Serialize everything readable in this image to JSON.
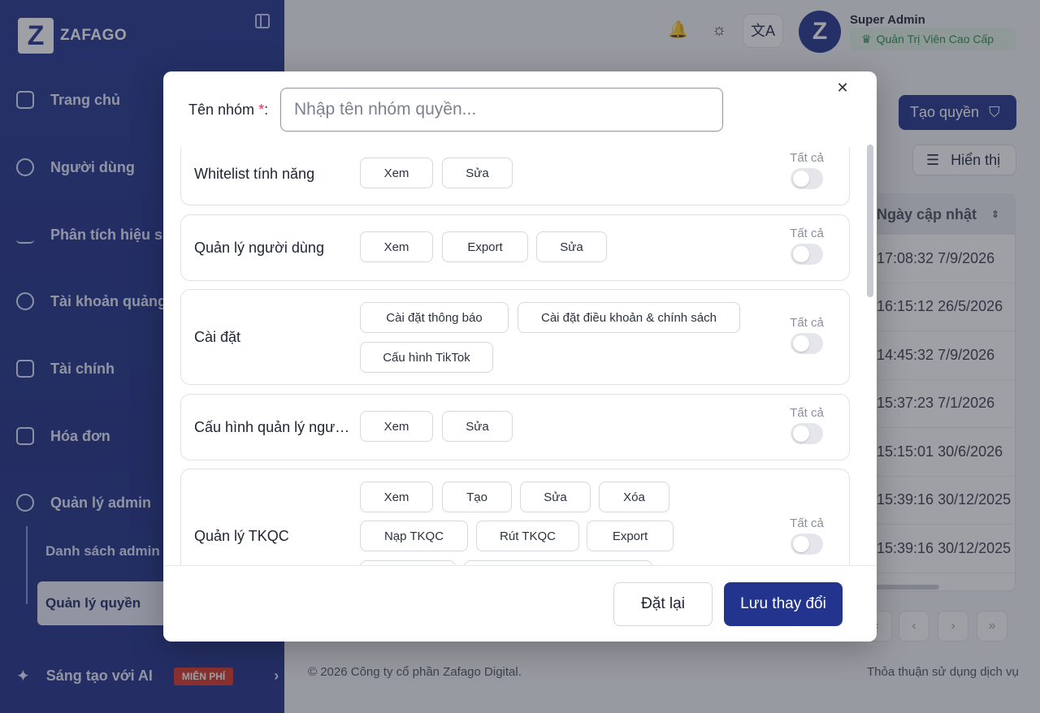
{
  "brand": {
    "logo_letter": "Z",
    "name": "ZAFAGO"
  },
  "sidebar": {
    "items": [
      {
        "label": "Trang chủ",
        "icon": "dashboard-icon"
      },
      {
        "label": "Người dùng",
        "icon": "user-icon"
      },
      {
        "label": "Phân tích hiệu suất",
        "icon": "chart-line-icon"
      },
      {
        "label": "Tài khoản quảng cáo",
        "icon": "network-icon"
      },
      {
        "label": "Tài chính",
        "icon": "wallet-icon"
      },
      {
        "label": "Hóa đơn",
        "icon": "invoice-icon"
      },
      {
        "label": "Quản lý admin",
        "icon": "users-icon"
      }
    ],
    "sub_items": [
      {
        "label": "Danh sách admin"
      },
      {
        "label": "Quản lý quyền",
        "active": true
      }
    ],
    "ai": {
      "label": "Sáng tạo với AI",
      "badge": "MIỄN PHÍ",
      "icon": "sparkle-icon"
    }
  },
  "header": {
    "user_name": "Super Admin",
    "user_role": "Quản Trị Viên Cao Cấp",
    "avatar_letter": "Z"
  },
  "page": {
    "create_label": "Tạo quyền",
    "display_label": "Hiển thị",
    "table_header": "Ngày cập nhật",
    "rows": [
      "17:08:32 7/9/2026",
      "16:15:12 26/5/2026",
      "14:45:32 7/9/2026",
      "15:37:23 7/1/2026",
      "15:15:01 30/6/2026",
      "15:39:16 30/12/2025",
      "15:39:16 30/12/2025"
    ],
    "footer_left": "© 2026 Công ty cổ phần Zafago Digital.",
    "footer_right": "Thỏa thuận sử dụng dịch vụ"
  },
  "modal": {
    "name_label": "Tên nhóm",
    "required_mark": "*",
    "name_colon": ":",
    "name_placeholder": "Nhập tên nhóm quyền...",
    "all_label": "Tất cả",
    "groups": [
      {
        "title": "Whitelist tính năng",
        "perms": [
          "Xem",
          "Sửa"
        ]
      },
      {
        "title": "Quản lý người dùng",
        "perms": [
          "Xem",
          "Export",
          "Sửa"
        ]
      },
      {
        "title": "Cài đặt",
        "perms": [
          "Cài đặt thông báo",
          "Cài đặt điều khoản & chính sách",
          "Cấu hình TikTok"
        ]
      },
      {
        "title": "Cấu hình quản lý người dùng",
        "perms": [
          "Xem",
          "Sửa"
        ]
      },
      {
        "title": "Quản lý TKQC",
        "perms": [
          "Xem",
          "Tạo",
          "Sửa",
          "Xóa",
          "Nạp TKQC",
          "Rút TKQC",
          "Export"
        ]
      }
    ],
    "reset_label": "Đặt lại",
    "save_label": "Lưu thay đổi"
  }
}
